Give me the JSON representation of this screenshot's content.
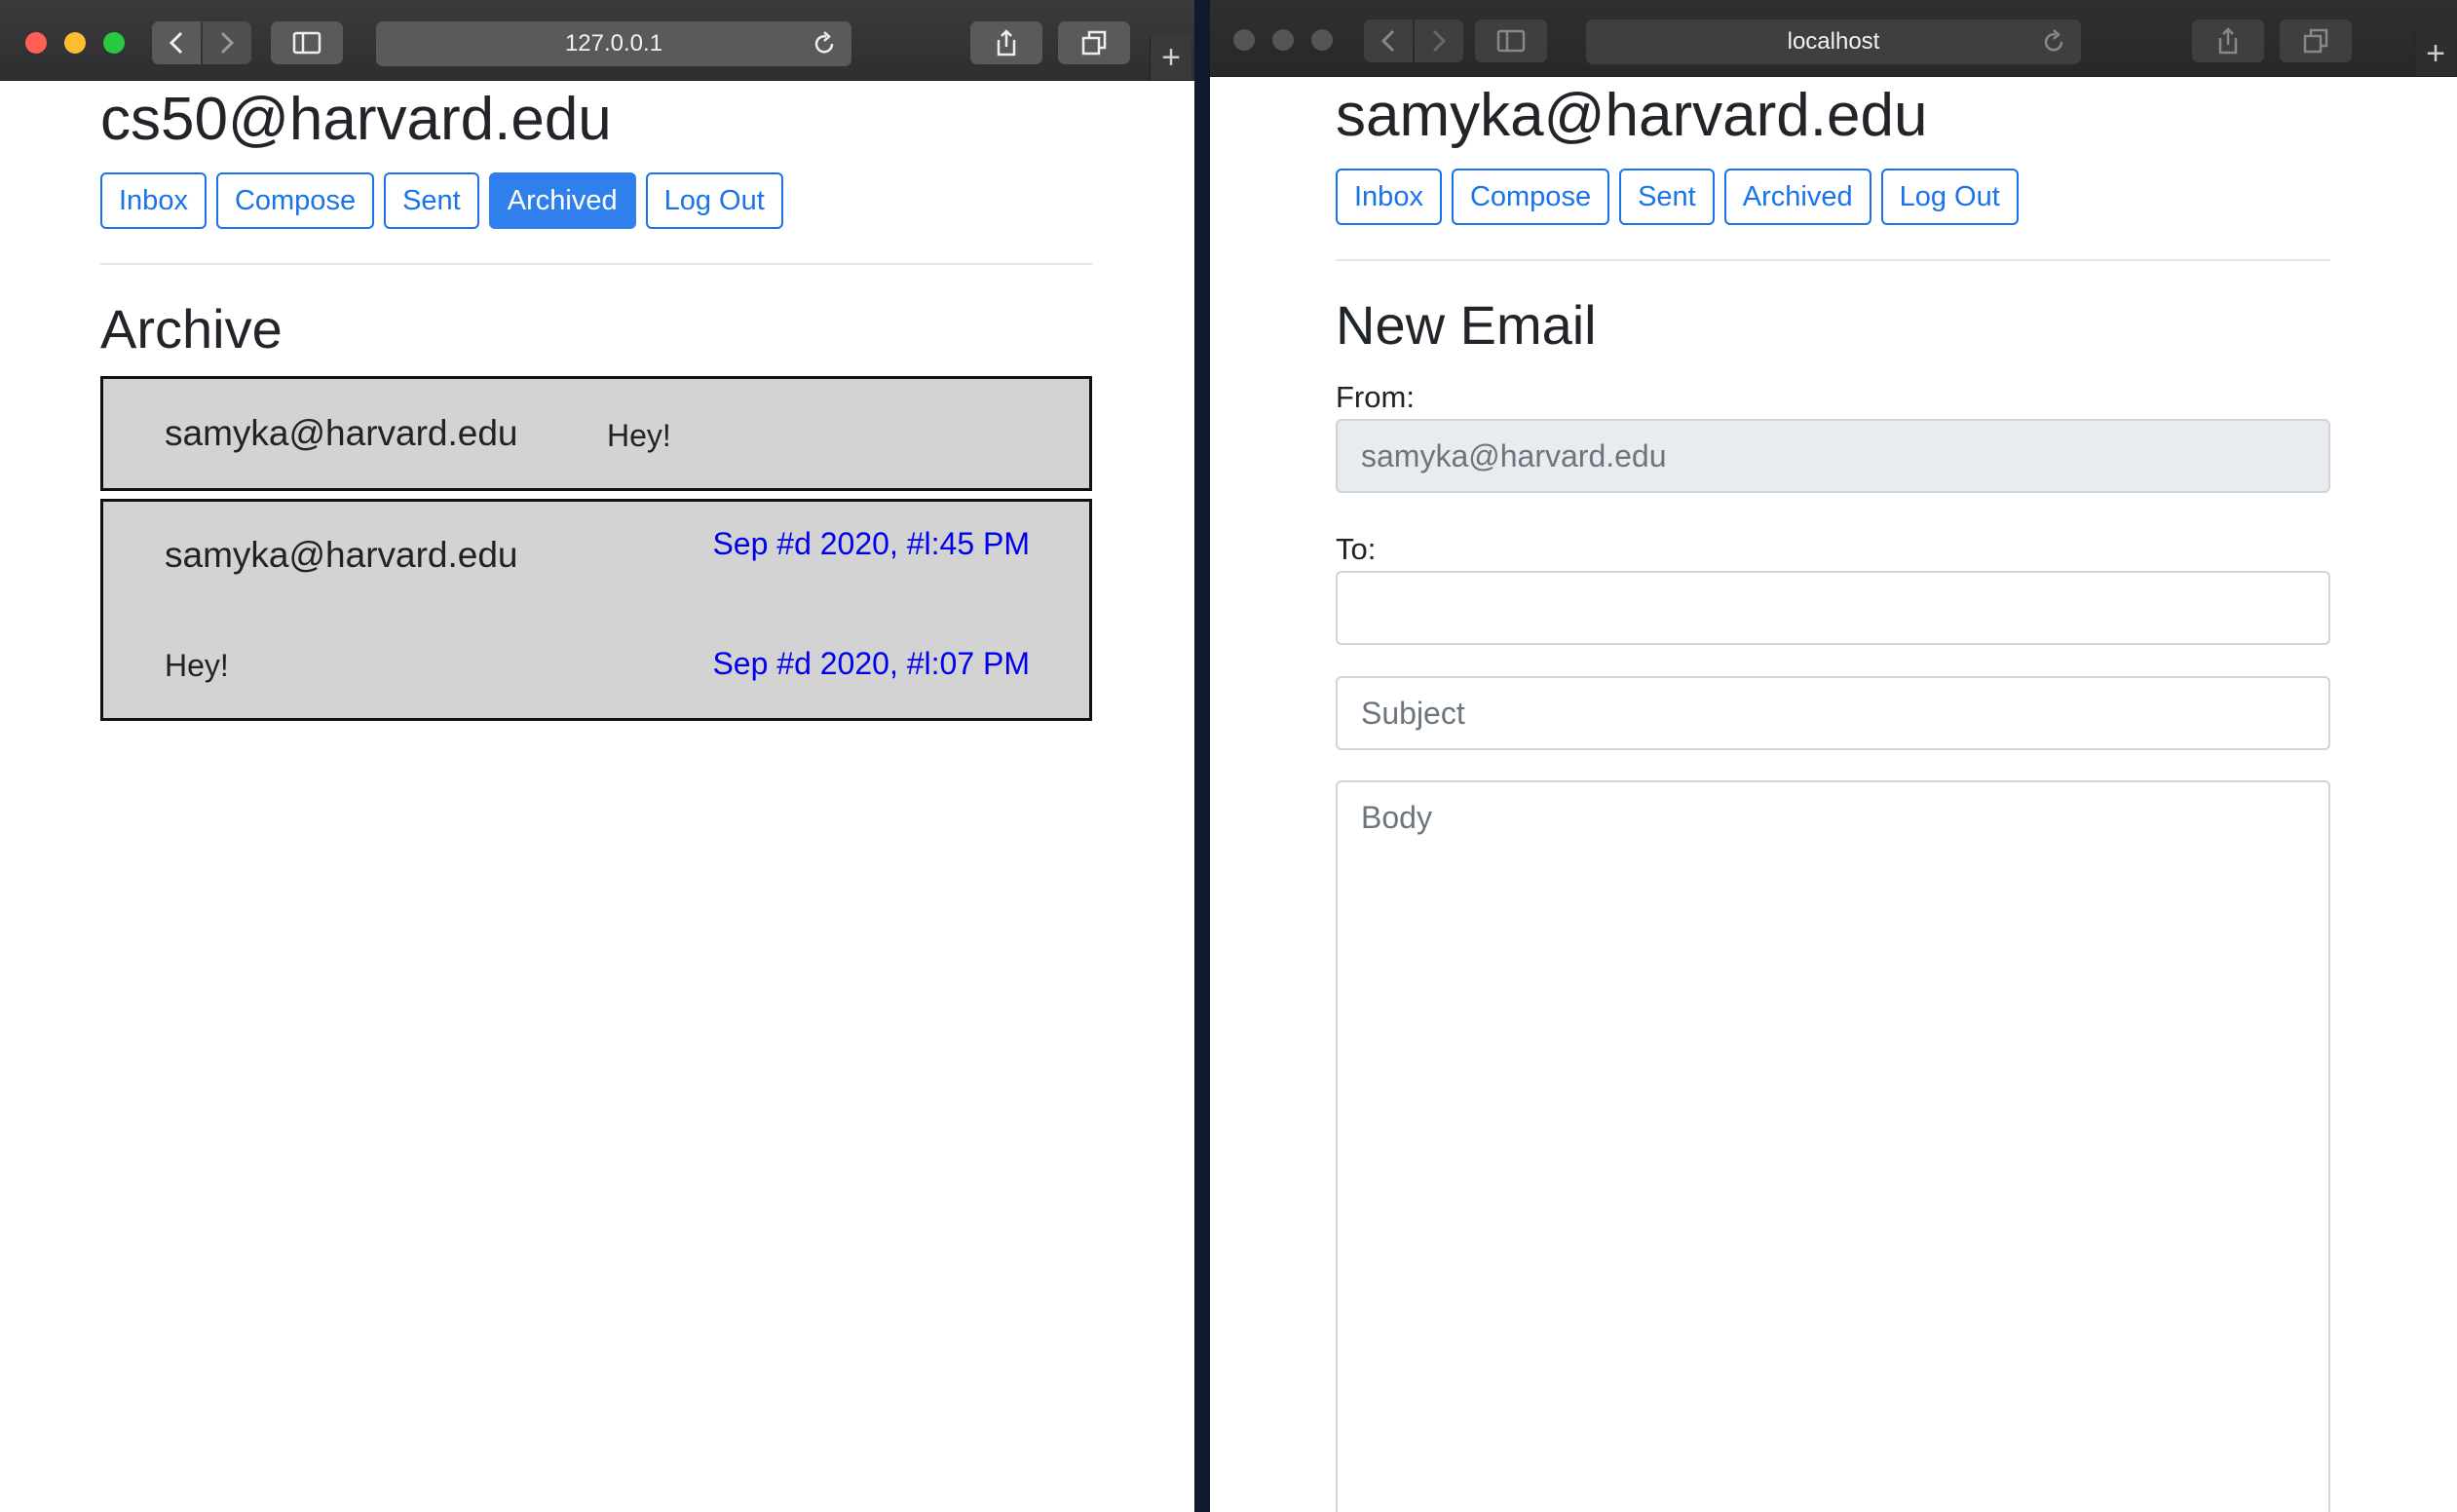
{
  "left_window": {
    "url": "127.0.0.1",
    "new_tab": "+",
    "user_email": "cs50@harvard.edu",
    "nav": {
      "inbox": "Inbox",
      "compose": "Compose",
      "sent": "Sent",
      "archived": "Archived",
      "logout": "Log Out"
    },
    "view_title": "Archive",
    "emails": [
      {
        "sender": "samyka@harvard.edu",
        "subject": "Hey!"
      },
      {
        "sender": "samyka@harvard.edu",
        "timestamp": "Sep #d 2020, #l:45 PM",
        "body": "Hey!",
        "timestamp2": "Sep #d 2020, #l:07 PM"
      }
    ]
  },
  "right_window": {
    "url": "localhost",
    "new_tab": "+",
    "user_email": "samyka@harvard.edu",
    "nav": {
      "inbox": "Inbox",
      "compose": "Compose",
      "sent": "Sent",
      "archived": "Archived",
      "logout": "Log Out"
    },
    "view_title": "New Email",
    "from_label": "From:",
    "from_value": "samyka@harvard.edu",
    "to_label": "To:",
    "subject_placeholder": "Subject",
    "body_placeholder": "Body"
  },
  "colors": {
    "accent": "#1a73e8",
    "active": "#2f80ed",
    "email_bg": "#d3d3d3",
    "timestamp": "#0000ee"
  },
  "icons": [
    "close-light",
    "minimize-light",
    "zoom-light",
    "chevron-left-icon",
    "chevron-right-icon",
    "sidebar-icon",
    "reload-icon",
    "share-icon",
    "tabs-icon",
    "plus-icon"
  ]
}
